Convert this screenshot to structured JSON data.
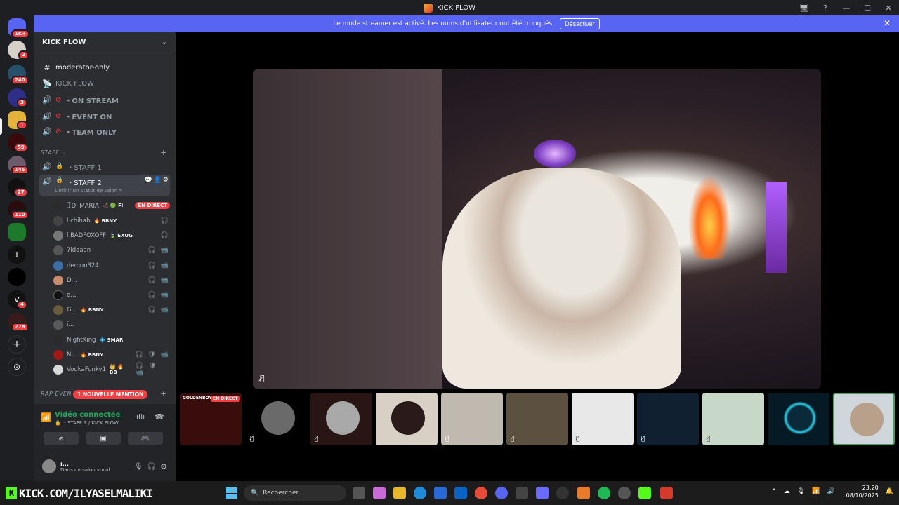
{
  "window": {
    "title": "KICK FLOW",
    "controls": [
      "🖥",
      "?",
      "—",
      "☐",
      "✕"
    ]
  },
  "banner": {
    "text": "Le mode streamer est activé. Les noms d'utilisateur ont été tronqués.",
    "button": "Désactiver",
    "close": "✕"
  },
  "rail": {
    "badges": [
      "1K+",
      "2",
      "240",
      "3",
      "1",
      "59",
      "145",
      "27",
      "110",
      "4",
      "278"
    ],
    "letters": [
      "I",
      "V"
    ]
  },
  "server": {
    "name": "KICK FLOW"
  },
  "channels": [
    {
      "label": "moderator-only",
      "icon": "#"
    },
    {
      "label": "KICK FLOW",
      "icon": "📡"
    },
    {
      "label": "・ON STREAM",
      "icon": "🔊"
    },
    {
      "label": "・EVENT ON",
      "icon": "🔊"
    },
    {
      "label": "・TEAM ONLY",
      "icon": "🔊"
    }
  ],
  "category_staff": "STAFF ⌄",
  "staff1": "・STAFF 1",
  "staff2": {
    "label": "・STAFF 2",
    "sub": "Définir un statut de salon ✎"
  },
  "members": [
    {
      "name": "ꀤDI MARIA",
      "tag": "🏹 🟢 Fi",
      "live": "EN DIRECT",
      "color": "#2b2b2b"
    },
    {
      "name": "l chihab",
      "tag": "🔥 BBNY",
      "icons": "🎧",
      "color": "#444"
    },
    {
      "name": "l BADFOXOFF",
      "tag": "🍃 EXUG",
      "icons": "🎧",
      "color": "#777"
    },
    {
      "name": "7idaaan",
      "tag": "",
      "icons": "🎧 📹",
      "color": "#555"
    },
    {
      "name": "demon324",
      "tag": "",
      "icons": "🎧 📹",
      "color": "#3a6fa8"
    },
    {
      "name": "D...",
      "tag": "",
      "icons": "🎧 📹",
      "color": "#c98c6e"
    },
    {
      "name": "d...",
      "tag": "",
      "icons": "🎧 📹",
      "color": "#111"
    },
    {
      "name": "G...",
      "tag": "🔥 BBNY",
      "icons": "🎧 📹",
      "color": "#6b5a3e"
    },
    {
      "name": "i...",
      "tag": "",
      "icons": "",
      "color": "#5a5a5a"
    },
    {
      "name": "NightKing",
      "tag": "💠 9MAR",
      "icons": "",
      "color": "#2a2a2a"
    },
    {
      "name": "N...",
      "tag": "🔥 BBNY",
      "icons": "🎧 🛡 📹",
      "color": "#a01818"
    },
    {
      "name": "VodkaFunky1",
      "tag": "👑 🔥 BB",
      "icons": "🎧 🛡 📹",
      "color": "#d9d9d9"
    }
  ],
  "category_rap": "RAP EVEN",
  "mention": "1 NOUVELLE MENTION",
  "voice": {
    "title": "Vidéo connectée",
    "sub": "🔒 ・STAFF 2 / KICK FLOW",
    "user": "i...",
    "status": "Dans un salon vocal"
  },
  "thumbs": [
    {
      "label": "GOLDENBOY",
      "live": "EN DIRECT",
      "color": "#3a0d0d"
    },
    {
      "color": "#000"
    },
    {
      "color": "#2a1515"
    },
    {
      "color": "#d8d0c4"
    },
    {
      "color": "#bfb9b0"
    },
    {
      "color": "#5c5040"
    },
    {
      "color": "#e8e8e8"
    },
    {
      "color": "#102030"
    },
    {
      "color": "#c8d8c8"
    },
    {
      "color": "#061a26"
    },
    {
      "color": "#cfd6dc"
    }
  ],
  "taskbar": {
    "kick": "KICK.COM/ILYASELMALIKI",
    "search": "Rechercher",
    "time": "23:20",
    "date": "08/10/2025"
  }
}
